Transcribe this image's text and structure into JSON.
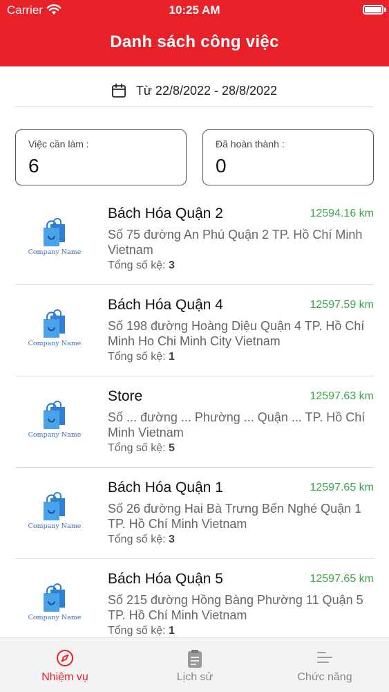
{
  "status_bar": {
    "carrier": "Carrier",
    "time": "10:25 AM"
  },
  "header": {
    "title": "Danh sách công việc"
  },
  "date_range": {
    "text": "Từ 22/8/2022 - 28/8/2022",
    "icon": "calendar-icon"
  },
  "stats": {
    "todo": {
      "label": "Việc cần làm :",
      "value": "6"
    },
    "done": {
      "label": "Đã hoàn thành :",
      "value": "0"
    }
  },
  "logo_text": "Company Name",
  "shelves_label": "Tổng số kệ: ",
  "tasks": [
    {
      "name": "Bách Hóa Quận 2",
      "distance": "12594.16 km",
      "address": "Số 75 đường An Phú Quận 2 TP. Hồ Chí Minh Vietnam",
      "shelves": "3"
    },
    {
      "name": "Bách Hóa Quận 4",
      "distance": "12597.59 km",
      "address": "Số 198 đường Hoàng Diệu Quận 4 TP. Hồ Chí Minh Ho Chi Minh City Vietnam",
      "shelves": "1"
    },
    {
      "name": "Store",
      "distance": "12597.63 km",
      "address": "Số ... đường ... Phường ... Quận ... TP. Hồ Chí Minh Vietnam",
      "shelves": "5"
    },
    {
      "name": "Bách Hóa Quận 1",
      "distance": "12597.65 km",
      "address": "Số 26 đường Hai Bà Trưng Bến Nghé Quận 1 TP. Hồ Chí Minh Vietnam",
      "shelves": "3"
    },
    {
      "name": "Bách Hóa Quận 5",
      "distance": "12597.65 km",
      "address": "Số 215 đường Hồng Bàng Phường 11 Quận 5 TP. Hồ Chí Minh Vietnam",
      "shelves": "1"
    }
  ],
  "tabs": [
    {
      "label": "Nhiệm vụ",
      "icon": "compass-icon",
      "active": true
    },
    {
      "label": "Lịch sử",
      "icon": "clipboard-icon",
      "active": false
    },
    {
      "label": "Chức năng",
      "icon": "menu-lines-icon",
      "active": false
    }
  ],
  "colors": {
    "primary": "#e82028",
    "distance": "#3aa844",
    "logo_blue": "#2f7fd6",
    "tab_inactive": "#888888"
  }
}
